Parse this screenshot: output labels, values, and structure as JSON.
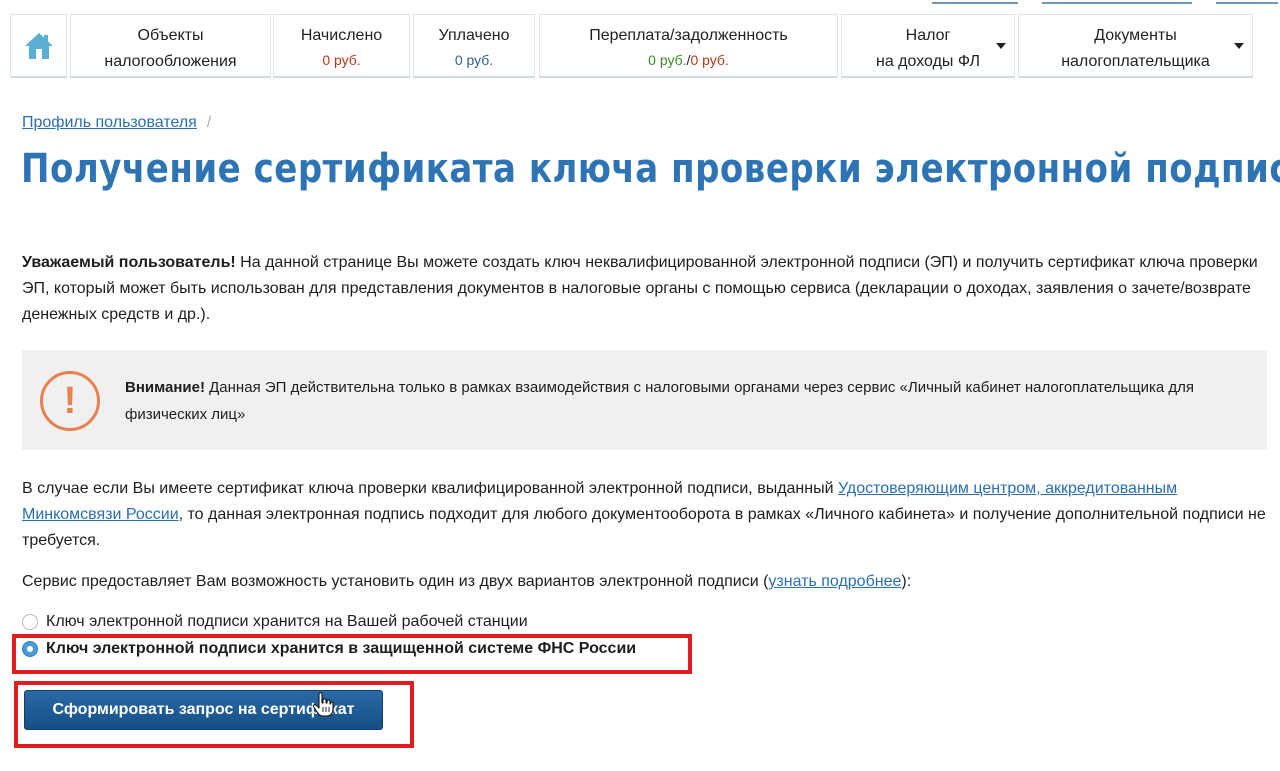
{
  "nav": {
    "objects": {
      "line1": "Объекты",
      "line2": "налогообложения"
    },
    "accrued": {
      "label": "Начислено",
      "value": "0 руб."
    },
    "paid": {
      "label": "Уплачено",
      "value": "0 руб."
    },
    "balance": {
      "label": "Переплата/задолженность",
      "overpay": "0 руб.",
      "sep": "/",
      "debt": "0 руб."
    },
    "income_tax": {
      "line1": "Налог",
      "line2": "на доходы ФЛ"
    },
    "documents": {
      "line1": "Документы",
      "line2": "налогоплательщика"
    }
  },
  "breadcrumb": {
    "link": "Профиль пользователя",
    "sep": "/"
  },
  "title": "Получение сертификата ключа проверки электронной подписи",
  "intro": {
    "bold": "Уважаемый пользователь!",
    "text": " На данной странице Вы можете создать ключ неквалифицированной электронной подписи (ЭП) и получить сертификат ключа проверки ЭП, который может быть использован для представления документов в налоговые органы с помощью сервиса (декларации о доходах, заявления о зачете/возврате денежных средств и др.)."
  },
  "notice": {
    "icon_text": "!",
    "bold": "Внимание!",
    "text": " Данная ЭП действительна только в рамках взаимодействия с налоговыми органами через сервис «Личный кабинет налогоплательщика для физических лиц»"
  },
  "qualified": {
    "before": "В случае если Вы имеете сертификат ключа проверки квалифицированной электронной подписи, выданный ",
    "link": "Удостоверяющим центром, аккредитованным Минкомсвязи России",
    "after": ", то данная электронная подпись подходит для любого документооборота в рамках «Личного кабинета» и получение дополнительной подписи не требуется."
  },
  "service": {
    "before": "Сервис предоставляет Вам возможность установить один из двух вариантов электронной подписи (",
    "link": "узнать подробнее",
    "after": "):"
  },
  "options": [
    {
      "label": "Ключ электронной подписи хранится на Вашей рабочей станции",
      "selected": false
    },
    {
      "label": "Ключ электронной подписи хранится в защищенной системе ФНС России",
      "selected": true
    }
  ],
  "submit_label": "Сформировать запрос на сертификат",
  "colors": {
    "title": "#2e74b4",
    "link": "#2a6fb4",
    "button": "#1d5a94",
    "highlight": "#e01e1e",
    "notice_icon": "#e8804e"
  }
}
